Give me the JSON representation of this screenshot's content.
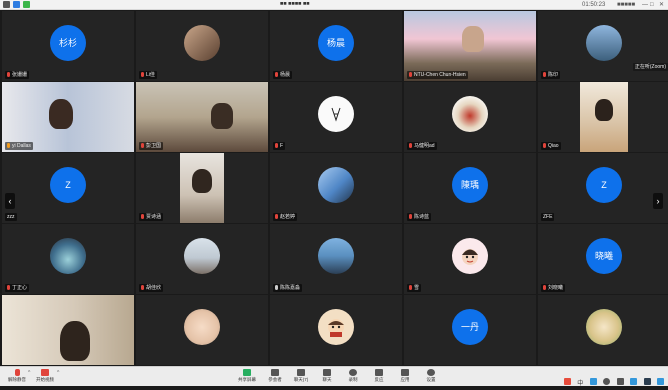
{
  "topbar": {
    "meeting_label": "■■ ■■■■ ■■",
    "time": "01:50:23",
    "right_label": "■■■■■",
    "window_controls": [
      "—",
      "□",
      "✕"
    ]
  },
  "participants": [
    {
      "name": "张姗姗",
      "avatar_text": "杉杉",
      "kind": "blue"
    },
    {
      "name": "Li佳",
      "kind": "photo"
    },
    {
      "name": "杨晨",
      "avatar_text": "杨晨",
      "kind": "blue"
    },
    {
      "name": "NTU-Chen Chun-Hsien",
      "kind": "video"
    },
    {
      "name": "陈印",
      "kind": "photo",
      "badge": "正在听(Zoom)"
    },
    {
      "name": "yi Dallas",
      "kind": "video",
      "active": true
    },
    {
      "name": "彭卫国",
      "kind": "video"
    },
    {
      "name": "F",
      "kind": "photo"
    },
    {
      "name": "马健明ad",
      "kind": "photo"
    },
    {
      "name": "Qiao",
      "kind": "video"
    },
    {
      "name": "zzz",
      "avatar_text": "Z",
      "kind": "blue"
    },
    {
      "name": "贾诗涵",
      "kind": "video"
    },
    {
      "name": "赵若婷",
      "kind": "photo"
    },
    {
      "name": "陈诗蓝",
      "avatar_text": "陳瑀",
      "kind": "blue"
    },
    {
      "name": "ZFE",
      "avatar_text": "Z",
      "kind": "blue"
    },
    {
      "name": "丁正心",
      "kind": "photo"
    },
    {
      "name": "胡佳欣",
      "kind": "photo"
    },
    {
      "name": "陈陈嘉淼",
      "kind": "photo"
    },
    {
      "name": "雪",
      "kind": "photo"
    },
    {
      "name": "刘晓曦",
      "avatar_text": "晓曦",
      "kind": "blue"
    },
    {
      "name": "",
      "kind": "video"
    },
    {
      "name": "",
      "kind": "photo"
    },
    {
      "name": "",
      "kind": "photo"
    },
    {
      "name": "",
      "avatar_text": "一丹",
      "kind": "blue"
    },
    {
      "name": "",
      "kind": "photo"
    }
  ],
  "navigation": {
    "prev": "‹",
    "next": "›"
  },
  "toolbar": {
    "left": [
      {
        "label": "解除静音",
        "icon": "mic-icon"
      },
      {
        "label": "开始视频",
        "icon": "video-icon"
      }
    ],
    "center": [
      {
        "label": "共享屏幕",
        "icon": "share-screen-icon"
      },
      {
        "label": "参会者",
        "icon": "participants-icon"
      },
      {
        "label": "聊天(7)",
        "icon": "chat-icon"
      },
      {
        "label": "聊天",
        "icon": "chat-bubble-icon"
      },
      {
        "label": "录制",
        "icon": "record-icon"
      },
      {
        "label": "反应",
        "icon": "reaction-icon"
      },
      {
        "label": "应用",
        "icon": "apps-icon"
      },
      {
        "label": "设置",
        "icon": "settings-icon"
      }
    ],
    "tray_icons": [
      "sougou-icon",
      "lang-icon",
      "moon-icon",
      "dot-icon",
      "mic-small-icon",
      "keyboard-icon",
      "shirt-icon",
      "grid-icon"
    ],
    "tray_text": "中"
  },
  "colors": {
    "accent_blue": "#0e71eb",
    "active_speaker": "#3bd16f",
    "muted": "#e0443b"
  }
}
